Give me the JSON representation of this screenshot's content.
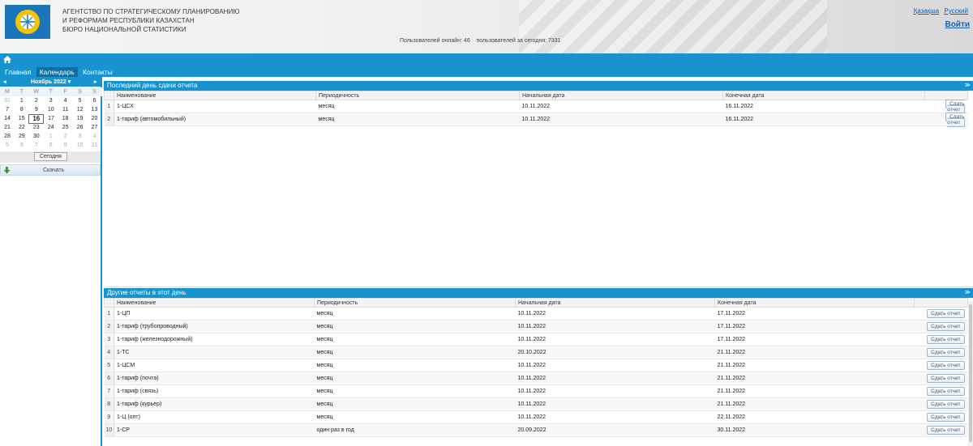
{
  "header": {
    "org_line1": "АГЕНТСТВО ПО СТРАТЕГИЧЕСКОМУ ПЛАНИРОВАНИЮ",
    "org_line2": "И РЕФОРМАМ РЕСПУБЛИКИ КАЗАХСТАН",
    "org_line3": "БЮРО НАЦИОНАЛЬНОЙ СТАТИСТИКИ",
    "online_text": "Пользователей онлайн: 46",
    "today_users_text": "пользователей за сегодня: 7331",
    "lang_kz": "Қазақша",
    "lang_ru": "Русский",
    "login": "Войти"
  },
  "nav": {
    "items": [
      "Главная",
      "Календарь",
      "Контакты"
    ]
  },
  "calendar": {
    "prev": "◂",
    "next": "▸",
    "month": "Ноябрь 2022",
    "month_caret": "▾",
    "weekdays": [
      "M",
      "T",
      "W",
      "T",
      "F",
      "S",
      "S"
    ],
    "weeks": [
      [
        "31",
        "1",
        "2",
        "3",
        "4",
        "5",
        "6"
      ],
      [
        "7",
        "8",
        "9",
        "10",
        "11",
        "12",
        "13"
      ],
      [
        "14",
        "15",
        "16",
        "17",
        "18",
        "19",
        "20"
      ],
      [
        "21",
        "22",
        "23",
        "24",
        "25",
        "26",
        "27"
      ],
      [
        "28",
        "29",
        "30",
        "1",
        "2",
        "3",
        "4"
      ],
      [
        "5",
        "6",
        "7",
        "8",
        "9",
        "10",
        "11"
      ]
    ],
    "today_button": "Сегодня",
    "download_label": "Скачать"
  },
  "panel1": {
    "title": "Последний день сдачи отчета",
    "collapse": "≫",
    "columns": [
      "Наименование",
      "Периодичность",
      "Начальная дата",
      "Конечная дата"
    ],
    "rows": [
      {
        "n": "1",
        "name": "1-ЦСХ",
        "period": "месяц",
        "start": "10.11.2022",
        "end": "16.11.2022",
        "action": "Сдать отчет"
      },
      {
        "n": "2",
        "name": "1-тариф (автомобильный)",
        "period": "месяц",
        "start": "10.11.2022",
        "end": "16.11.2022",
        "action": "Сдать отчет"
      }
    ]
  },
  "panel2": {
    "title": "Другие отчеты в этот день",
    "collapse": "≫",
    "columns": [
      "Наименование",
      "Периодичность",
      "Начальная дата",
      "Конечная дата"
    ],
    "rows": [
      {
        "n": "1",
        "name": "1-ЦП",
        "period": "месяц",
        "start": "10.11.2022",
        "end": "17.11.2022",
        "action": "Сдать отчет"
      },
      {
        "n": "2",
        "name": "1-тариф (трубопроводный)",
        "period": "месяц",
        "start": "10.11.2022",
        "end": "17.11.2022",
        "action": "Сдать отчет"
      },
      {
        "n": "3",
        "name": "1-тариф (железнодорожный)",
        "period": "месяц",
        "start": "10.11.2022",
        "end": "17.11.2022",
        "action": "Сдать отчет"
      },
      {
        "n": "4",
        "name": "1-ТС",
        "period": "месяц",
        "start": "20.10.2022",
        "end": "21.11.2022",
        "action": "Сдать отчет"
      },
      {
        "n": "5",
        "name": "1-ЦСМ",
        "period": "месяц",
        "start": "10.11.2022",
        "end": "21.11.2022",
        "action": "Сдать отчет"
      },
      {
        "n": "6",
        "name": "1-тариф (почта)",
        "period": "месяц",
        "start": "10.11.2022",
        "end": "21.11.2022",
        "action": "Сдать отчет"
      },
      {
        "n": "7",
        "name": "1-тариф (связь)",
        "period": "месяц",
        "start": "10.11.2022",
        "end": "21.11.2022",
        "action": "Сдать отчет"
      },
      {
        "n": "8",
        "name": "1-тариф (курьер)",
        "period": "месяц",
        "start": "10.11.2022",
        "end": "21.11.2022",
        "action": "Сдать отчет"
      },
      {
        "n": "9",
        "name": "1-Ц (опт)",
        "period": "месяц",
        "start": "10.11.2022",
        "end": "22.11.2022",
        "action": "Сдать отчет"
      },
      {
        "n": "10",
        "name": "1-СР",
        "period": "один раз в год",
        "start": "20.09.2022",
        "end": "30.11.2022",
        "action": "Сдать отчет"
      }
    ]
  }
}
